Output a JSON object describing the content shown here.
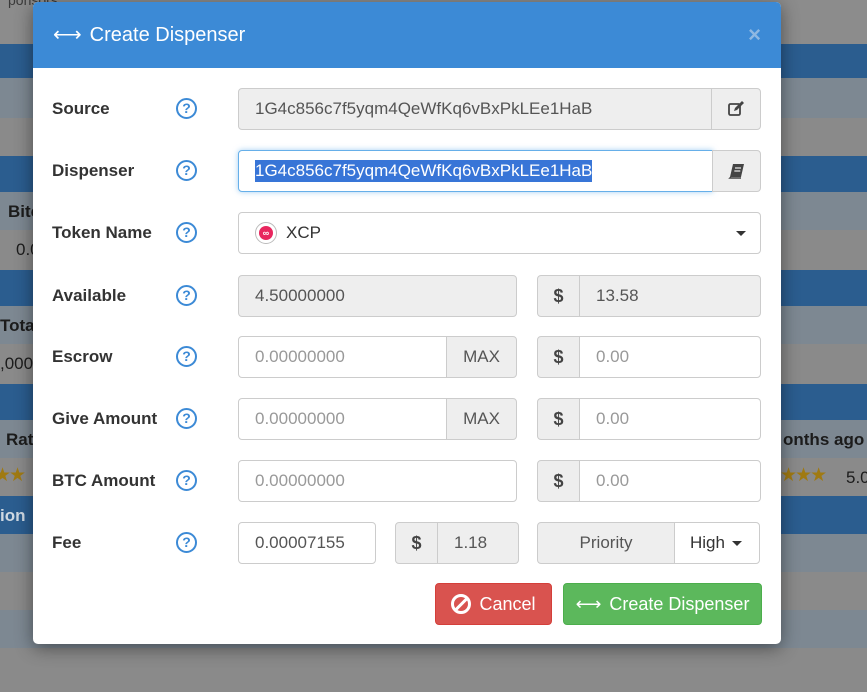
{
  "background": {
    "partial_texts": [
      "ponsors",
      "Bitc",
      "0.0",
      "Tota",
      ",000",
      "Rat",
      "onths ago",
      "5.0",
      "ion"
    ]
  },
  "modal": {
    "title": "Create Dispenser",
    "close_label": "×",
    "fields": {
      "source": {
        "label": "Source",
        "value": "1G4c856c7f5yqm4QeWfKq6vBxPkLEe1HaB"
      },
      "dispenser": {
        "label": "Dispenser",
        "value": "1G4c856c7f5yqm4QeWfKq6vBxPkLEe1HaB"
      },
      "token_name": {
        "label": "Token Name",
        "value": "XCP",
        "logo_text": "∞"
      },
      "available": {
        "label": "Available",
        "value": "4.50000000",
        "currency_symbol": "$",
        "usd_value": "13.58"
      },
      "escrow": {
        "label": "Escrow",
        "placeholder": "0.00000000",
        "max_label": "MAX",
        "currency_symbol": "$",
        "usd_placeholder": "0.00"
      },
      "give_amount": {
        "label": "Give Amount",
        "placeholder": "0.00000000",
        "max_label": "MAX",
        "currency_symbol": "$",
        "usd_placeholder": "0.00"
      },
      "btc_amount": {
        "label": "BTC Amount",
        "placeholder": "0.00000000",
        "currency_symbol": "$",
        "usd_placeholder": "0.00"
      },
      "fee": {
        "label": "Fee",
        "value": "0.00007155",
        "currency_symbol": "$",
        "usd_value": "1.18",
        "priority_label": "Priority",
        "priority_value": "High"
      }
    },
    "help_glyph": "?",
    "buttons": {
      "cancel": "Cancel",
      "create": "Create Dispenser"
    }
  },
  "colors": {
    "header": "#3c8ad6",
    "cancel": "#d9534f",
    "create": "#5cb85c"
  }
}
